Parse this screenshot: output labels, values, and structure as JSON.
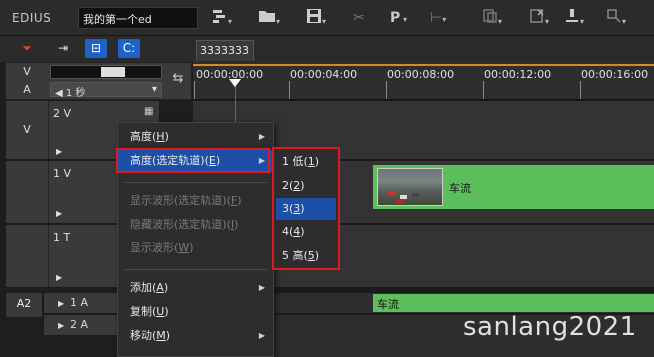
{
  "app": {
    "name": "EDIUS",
    "project_name": "我的第一个ed"
  },
  "toolbar": {
    "items": [
      {
        "icon": "sequence-icon"
      },
      {
        "icon": "folder-icon"
      },
      {
        "icon": "save-icon"
      },
      {
        "icon": "cut-icon"
      },
      {
        "label": "P"
      },
      {
        "icon": "trim-icon"
      },
      {
        "icon": "copy-icon"
      },
      {
        "icon": "delete-icon"
      },
      {
        "icon": "marker-icon"
      },
      {
        "icon": "zoom-icon"
      }
    ]
  },
  "sequence_tab": "3333333",
  "header": {
    "v": "V",
    "a": "A",
    "scale": "1 秒"
  },
  "ruler": {
    "timecodes": [
      "00:00:00:00",
      "00:00:04:00",
      "00:00:08:00",
      "00:00:12:00",
      "00:00:16:00"
    ]
  },
  "tracks": {
    "v2": {
      "name": "2 V",
      "type_label": "V"
    },
    "v1": {
      "name": "1 V",
      "clip_name": "车流"
    },
    "t1": {
      "name": "1 T"
    },
    "a1": {
      "name": "1 A",
      "clip_name": "车流"
    },
    "a2": {
      "name": "2 A"
    },
    "a12_label": "A2"
  },
  "context_menu": {
    "items": [
      {
        "label": "高度(",
        "key": "H",
        "suffix": ")",
        "has_submenu": true
      },
      {
        "label": "高度(选定轨道)(",
        "key": "E",
        "suffix": ")",
        "has_submenu": true
      },
      {
        "label": "显示波形(选定轨道)(",
        "key": "F",
        "suffix": ")"
      },
      {
        "label": "隐藏波形(选定轨道)(",
        "key": "I",
        "suffix": ")"
      },
      {
        "label": "显示波形(",
        "key": "W",
        "suffix": ")"
      },
      {
        "label": "添加(",
        "key": "A",
        "suffix": ")",
        "has_submenu": true
      },
      {
        "label": "复制(",
        "key": "U",
        "suffix": ")"
      },
      {
        "label": "移动(",
        "key": "M",
        "suffix": ")",
        "has_submenu": true
      }
    ]
  },
  "submenu": {
    "items": [
      {
        "label": "1 低(",
        "key": "1",
        "suffix": ")"
      },
      {
        "label": "2(",
        "key": "2",
        "suffix": ")"
      },
      {
        "label": "3(",
        "key": "3",
        "suffix": ")"
      },
      {
        "label": "4(",
        "key": "4",
        "suffix": ")"
      },
      {
        "label": "5 高(",
        "key": "5",
        "suffix": ")"
      }
    ],
    "selected_index": 2
  },
  "watermark": "sanlang2021",
  "colors": {
    "highlight": "#1d4fa8",
    "clip_green": "#5cbf5c",
    "annotation_red": "#e0191f",
    "ruler_orange": "#d88a1c"
  }
}
